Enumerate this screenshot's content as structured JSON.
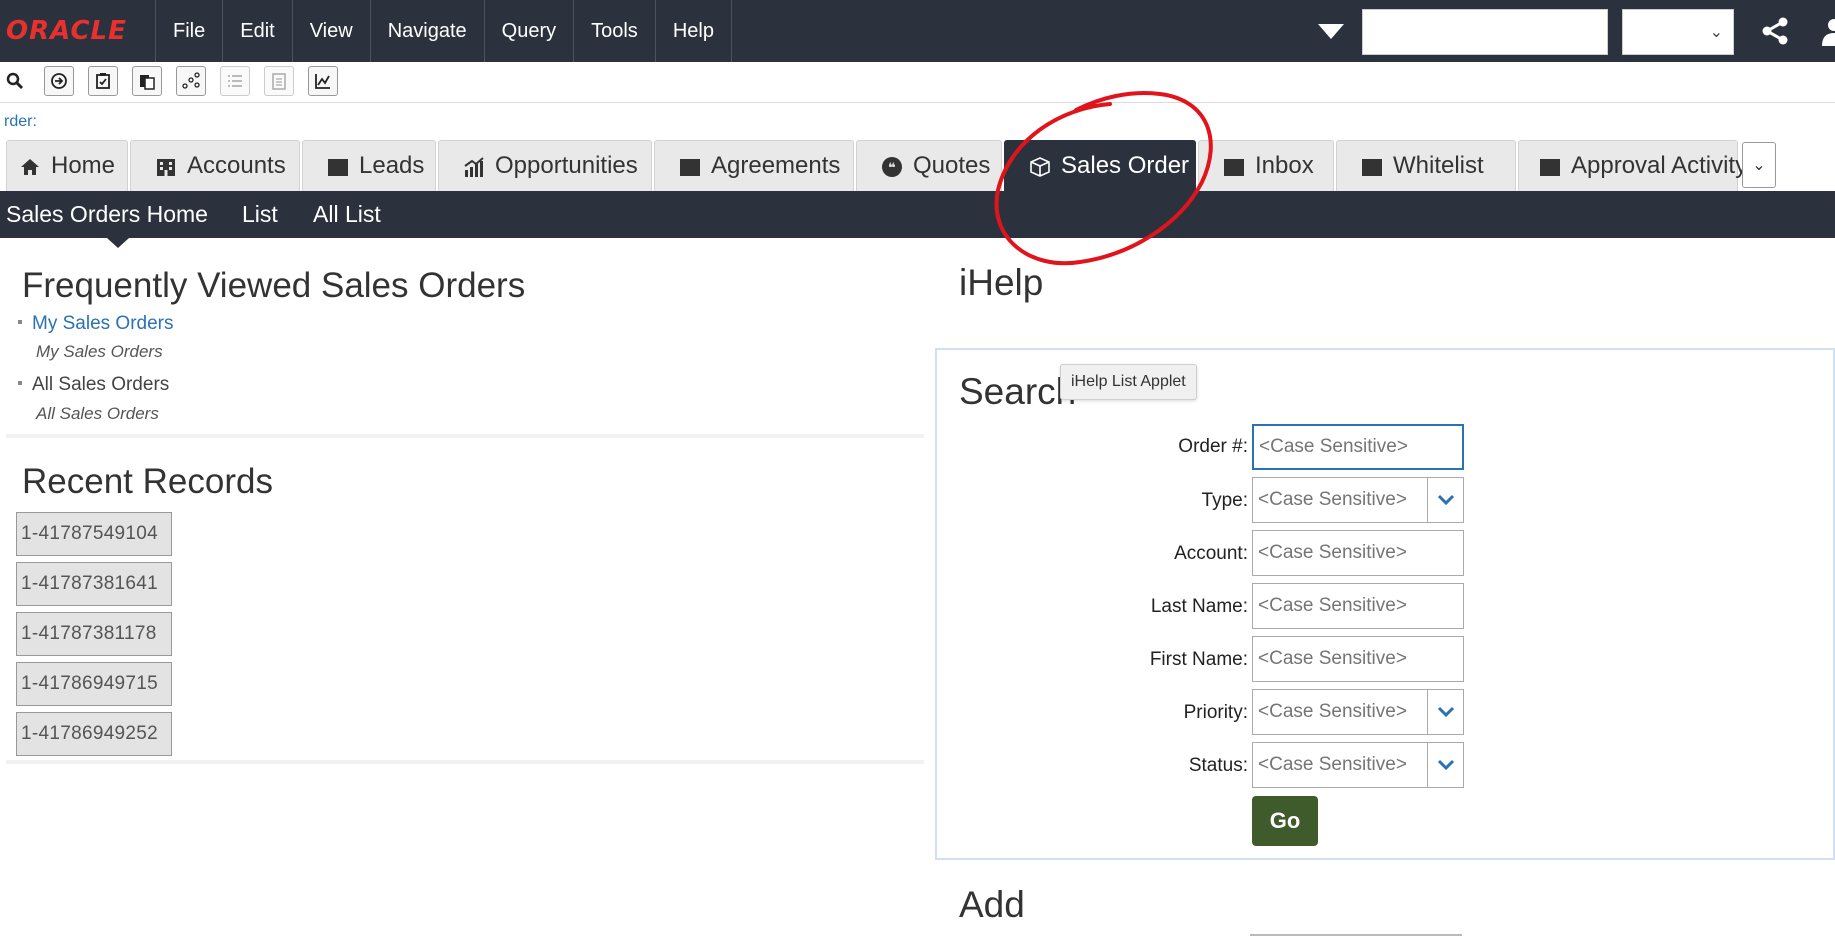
{
  "app": {
    "logo_text": "ORACLE",
    "menus": [
      "File",
      "Edit",
      "View",
      "Navigate",
      "Query",
      "Tools",
      "Help"
    ],
    "search_value": "",
    "select_value": ""
  },
  "toolbar": {
    "buttons": [
      {
        "icon": "search-icon"
      },
      {
        "icon": "go-icon"
      },
      {
        "icon": "task-icon"
      },
      {
        "icon": "clipboard-icon"
      },
      {
        "icon": "connections-icon"
      },
      {
        "icon": "list-icon",
        "disabled": true
      },
      {
        "icon": "document-icon",
        "disabled": true
      },
      {
        "icon": "chart-icon"
      }
    ]
  },
  "breadcrumb": "rder:",
  "tabs": [
    {
      "label": "Home",
      "icon": "home-icon"
    },
    {
      "label": "Accounts",
      "icon": "accounts-icon"
    },
    {
      "label": "Leads",
      "icon": "leads-icon"
    },
    {
      "label": "Opportunities",
      "icon": "opportunities-icon"
    },
    {
      "label": "Agreements",
      "icon": "agreements-icon"
    },
    {
      "label": "Quotes",
      "icon": "quotes-icon"
    },
    {
      "label": "Sales Order",
      "icon": "sales-order-icon",
      "active": true
    },
    {
      "label": "Inbox",
      "icon": "inbox-icon"
    },
    {
      "label": "Whitelist",
      "icon": "whitelist-icon"
    },
    {
      "label": "Approval Activity",
      "icon": "approval-icon"
    }
  ],
  "views": [
    "Sales Orders Home",
    "List",
    "All List"
  ],
  "frequently_viewed": {
    "title": "Frequently Viewed Sales Orders",
    "items": [
      {
        "label": "My Sales Orders",
        "desc": "My Sales Orders"
      },
      {
        "label": "All Sales Orders",
        "desc": "All Sales Orders"
      }
    ]
  },
  "recent_records": {
    "title": "Recent Records",
    "items": [
      "1-41787549104",
      "1-41787381641",
      "1-41787381178",
      "1-41786949715",
      "1-41786949252"
    ]
  },
  "ihelp": {
    "title": "iHelp",
    "tooltip": "iHelp List Applet"
  },
  "search": {
    "title": "Search",
    "fields": [
      {
        "label": "Order #:",
        "placeholder": "<Case Sensitive>"
      },
      {
        "label": "Type:",
        "placeholder": "<Case Sensitive>"
      },
      {
        "label": "Account:",
        "placeholder": "<Case Sensitive>"
      },
      {
        "label": "Last Name:",
        "placeholder": "<Case Sensitive>"
      },
      {
        "label": "First Name:",
        "placeholder": "<Case Sensitive>"
      },
      {
        "label": "Priority:",
        "placeholder": "<Case Sensitive>"
      },
      {
        "label": "Status:",
        "placeholder": "<Case Sensitive>"
      }
    ],
    "go_label": "Go"
  },
  "add": {
    "title": "Add"
  },
  "colors": {
    "menubar": "#2b323d",
    "link": "#2a72b5",
    "go_button": "#3f5a2b",
    "logo": "#e8312f",
    "annotation": "#e0151b"
  }
}
